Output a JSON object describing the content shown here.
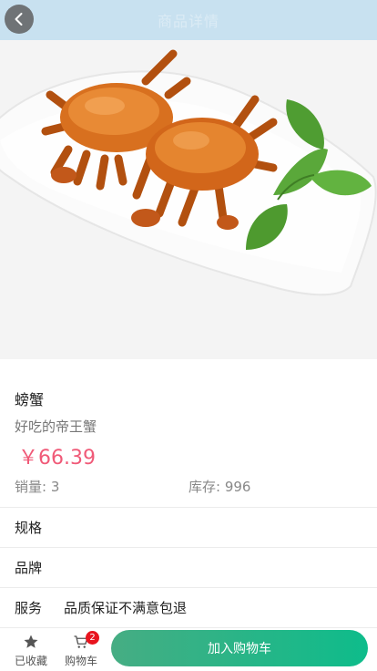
{
  "header": {
    "title": "商品详情",
    "back_icon": "chevron-left-icon"
  },
  "product": {
    "image_alt": "螃蟹",
    "name": "螃蟹",
    "subtitle": "好吃的帝王蟹",
    "price": "￥66.39",
    "sales": "销量: 3",
    "stock": "库存: 996"
  },
  "details": {
    "spec_label": "规格",
    "brand_label": "品牌",
    "service_label": "服务",
    "service_value": "品质保证不满意包退"
  },
  "bottom_bar": {
    "favorite_label": "已收藏",
    "favorite_icon": "star-icon",
    "cart_label": "购物车",
    "cart_icon": "cart-icon",
    "cart_count": "2",
    "add_to_cart_label": "加入购物车"
  },
  "colors": {
    "header_bg": "#c8e1f0",
    "price": "#f05a78",
    "button_start": "#46ad83",
    "button_end": "#0ebc8b",
    "badge": "#e8141e"
  }
}
